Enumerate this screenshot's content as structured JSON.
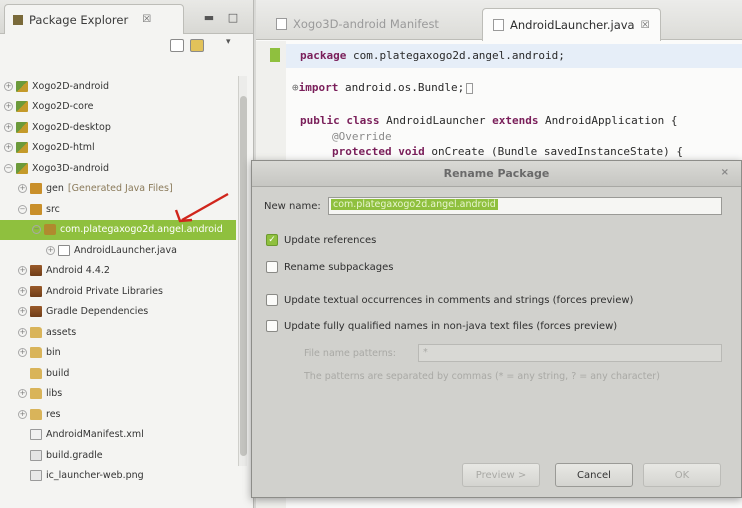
{
  "explorer": {
    "tab_label": "Package Explorer",
    "tab_close": "☒",
    "tree": [
      {
        "label": "Xogo2D-android",
        "icon": "project-icon",
        "expander": "+",
        "indent": 0
      },
      {
        "label": "Xogo2D-core",
        "icon": "project-icon",
        "expander": "+",
        "indent": 0
      },
      {
        "label": "Xogo2D-desktop",
        "icon": "project-icon",
        "expander": "+",
        "indent": 0
      },
      {
        "label": "Xogo2D-html",
        "icon": "project-icon",
        "expander": "+",
        "indent": 0
      },
      {
        "label": "Xogo3D-android",
        "icon": "project-icon",
        "expander": "−",
        "indent": 0
      },
      {
        "label": "gen",
        "decoration": "[Generated Java Files]",
        "icon": "source-folder-icon",
        "expander": "+",
        "indent": 1
      },
      {
        "label": "src",
        "icon": "source-folder-icon",
        "expander": "−",
        "indent": 1
      },
      {
        "label": "com.plategaxogo2d.angel.android",
        "icon": "package-icon",
        "expander": "−",
        "indent": 2,
        "selected": true
      },
      {
        "label": "AndroidLauncher.java",
        "icon": "java-file-icon",
        "expander": "+",
        "indent": 3
      },
      {
        "label": "Android 4.4.2",
        "icon": "library-icon",
        "expander": "+",
        "indent": 1
      },
      {
        "label": "Android Private Libraries",
        "icon": "library-icon",
        "expander": "+",
        "indent": 1
      },
      {
        "label": "Gradle Dependencies",
        "icon": "library-icon",
        "expander": "+",
        "indent": 1
      },
      {
        "label": "assets",
        "icon": "folder-icon",
        "expander": "+",
        "indent": 1
      },
      {
        "label": "bin",
        "icon": "folder-icon",
        "expander": "+",
        "indent": 1
      },
      {
        "label": "build",
        "icon": "folder-icon",
        "expander": "",
        "indent": 1
      },
      {
        "label": "libs",
        "icon": "folder-icon",
        "expander": "+",
        "indent": 1
      },
      {
        "label": "res",
        "icon": "folder-icon",
        "expander": "+",
        "indent": 1
      },
      {
        "label": "AndroidManifest.xml",
        "icon": "xml-file-icon",
        "expander": "",
        "indent": 1
      },
      {
        "label": "build.gradle",
        "icon": "gradle-file-icon",
        "expander": "",
        "indent": 1
      },
      {
        "label": "ic_launcher-web.png",
        "icon": "image-file-icon",
        "expander": "",
        "indent": 1
      }
    ]
  },
  "editor": {
    "tabs": [
      {
        "label": "Xogo3D-android Manifest",
        "active": false
      },
      {
        "label": "AndroidLauncher.java",
        "active": true
      }
    ],
    "tab_close": "☒",
    "code": {
      "package_kw": "package",
      "package_name": " com.plategaxogo2d.angel.android;",
      "import_kw": "import",
      "import_name": " android.os.Bundle;",
      "class_kw1": "public class",
      "class_name": " AndroidLauncher ",
      "class_kw2": "extends",
      "class_super": " AndroidApplication {",
      "annotation": "@Override",
      "method_kw": "protected void",
      "method_sig": " onCreate (Bundle savedInstanceState) {"
    }
  },
  "dialog": {
    "title": "Rename Package",
    "close": "×",
    "new_name_label": "New name:",
    "new_name_value": "com.plategaxogo2d.angel.android",
    "options": [
      {
        "label": "Update references",
        "checked": true
      },
      {
        "label": "Rename subpackages",
        "checked": false
      },
      {
        "label": "Update textual occurrences in comments and strings (forces preview)",
        "checked": false
      },
      {
        "label": "Update fully qualified names in non-java text files (forces preview)",
        "checked": false
      }
    ],
    "file_patterns_label": "File name patterns:",
    "file_patterns_value": "*",
    "patterns_hint": "The patterns are separated by commas (* = any string, ? = any character)",
    "buttons": {
      "preview": "Preview >",
      "cancel": "Cancel",
      "ok": "OK"
    }
  },
  "colors": {
    "selection": "#8fc03e",
    "keyword": "#7a1f5a"
  }
}
